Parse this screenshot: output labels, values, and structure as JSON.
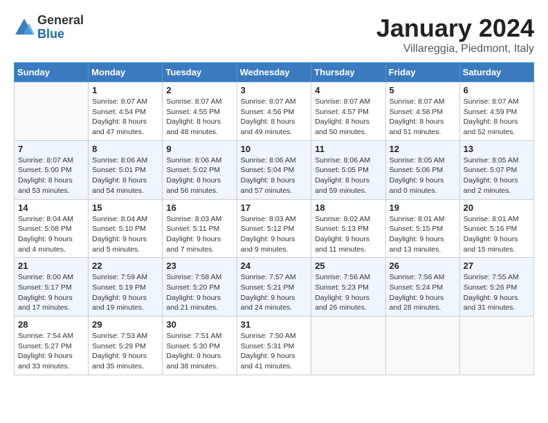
{
  "header": {
    "logo_general": "General",
    "logo_blue": "Blue",
    "title": "January 2024",
    "location": "Villareggia, Piedmont, Italy"
  },
  "weekdays": [
    "Sunday",
    "Monday",
    "Tuesday",
    "Wednesday",
    "Thursday",
    "Friday",
    "Saturday"
  ],
  "days": [
    {
      "day": "",
      "info": ""
    },
    {
      "day": "1",
      "info": "Sunrise: 8:07 AM\nSunset: 4:54 PM\nDaylight: 8 hours\nand 47 minutes."
    },
    {
      "day": "2",
      "info": "Sunrise: 8:07 AM\nSunset: 4:55 PM\nDaylight: 8 hours\nand 48 minutes."
    },
    {
      "day": "3",
      "info": "Sunrise: 8:07 AM\nSunset: 4:56 PM\nDaylight: 8 hours\nand 49 minutes."
    },
    {
      "day": "4",
      "info": "Sunrise: 8:07 AM\nSunset: 4:57 PM\nDaylight: 8 hours\nand 50 minutes."
    },
    {
      "day": "5",
      "info": "Sunrise: 8:07 AM\nSunset: 4:58 PM\nDaylight: 8 hours\nand 51 minutes."
    },
    {
      "day": "6",
      "info": "Sunrise: 8:07 AM\nSunset: 4:59 PM\nDaylight: 8 hours\nand 52 minutes."
    },
    {
      "day": "7",
      "info": "Sunrise: 8:07 AM\nSunset: 5:00 PM\nDaylight: 8 hours\nand 53 minutes."
    },
    {
      "day": "8",
      "info": "Sunrise: 8:06 AM\nSunset: 5:01 PM\nDaylight: 8 hours\nand 54 minutes."
    },
    {
      "day": "9",
      "info": "Sunrise: 8:06 AM\nSunset: 5:02 PM\nDaylight: 8 hours\nand 56 minutes."
    },
    {
      "day": "10",
      "info": "Sunrise: 8:06 AM\nSunset: 5:04 PM\nDaylight: 8 hours\nand 57 minutes."
    },
    {
      "day": "11",
      "info": "Sunrise: 8:06 AM\nSunset: 5:05 PM\nDaylight: 8 hours\nand 59 minutes."
    },
    {
      "day": "12",
      "info": "Sunrise: 8:05 AM\nSunset: 5:06 PM\nDaylight: 9 hours\nand 0 minutes."
    },
    {
      "day": "13",
      "info": "Sunrise: 8:05 AM\nSunset: 5:07 PM\nDaylight: 9 hours\nand 2 minutes."
    },
    {
      "day": "14",
      "info": "Sunrise: 8:04 AM\nSunset: 5:08 PM\nDaylight: 9 hours\nand 4 minutes."
    },
    {
      "day": "15",
      "info": "Sunrise: 8:04 AM\nSunset: 5:10 PM\nDaylight: 9 hours\nand 5 minutes."
    },
    {
      "day": "16",
      "info": "Sunrise: 8:03 AM\nSunset: 5:11 PM\nDaylight: 9 hours\nand 7 minutes."
    },
    {
      "day": "17",
      "info": "Sunrise: 8:03 AM\nSunset: 5:12 PM\nDaylight: 9 hours\nand 9 minutes."
    },
    {
      "day": "18",
      "info": "Sunrise: 8:02 AM\nSunset: 5:13 PM\nDaylight: 9 hours\nand 11 minutes."
    },
    {
      "day": "19",
      "info": "Sunrise: 8:01 AM\nSunset: 5:15 PM\nDaylight: 9 hours\nand 13 minutes."
    },
    {
      "day": "20",
      "info": "Sunrise: 8:01 AM\nSunset: 5:16 PM\nDaylight: 9 hours\nand 15 minutes."
    },
    {
      "day": "21",
      "info": "Sunrise: 8:00 AM\nSunset: 5:17 PM\nDaylight: 9 hours\nand 17 minutes."
    },
    {
      "day": "22",
      "info": "Sunrise: 7:59 AM\nSunset: 5:19 PM\nDaylight: 9 hours\nand 19 minutes."
    },
    {
      "day": "23",
      "info": "Sunrise: 7:58 AM\nSunset: 5:20 PM\nDaylight: 9 hours\nand 21 minutes."
    },
    {
      "day": "24",
      "info": "Sunrise: 7:57 AM\nSunset: 5:21 PM\nDaylight: 9 hours\nand 24 minutes."
    },
    {
      "day": "25",
      "info": "Sunrise: 7:56 AM\nSunset: 5:23 PM\nDaylight: 9 hours\nand 26 minutes."
    },
    {
      "day": "26",
      "info": "Sunrise: 7:56 AM\nSunset: 5:24 PM\nDaylight: 9 hours\nand 28 minutes."
    },
    {
      "day": "27",
      "info": "Sunrise: 7:55 AM\nSunset: 5:26 PM\nDaylight: 9 hours\nand 31 minutes."
    },
    {
      "day": "28",
      "info": "Sunrise: 7:54 AM\nSunset: 5:27 PM\nDaylight: 9 hours\nand 33 minutes."
    },
    {
      "day": "29",
      "info": "Sunrise: 7:53 AM\nSunset: 5:29 PM\nDaylight: 9 hours\nand 35 minutes."
    },
    {
      "day": "30",
      "info": "Sunrise: 7:51 AM\nSunset: 5:30 PM\nDaylight: 9 hours\nand 38 minutes."
    },
    {
      "day": "31",
      "info": "Sunrise: 7:50 AM\nSunset: 5:31 PM\nDaylight: 9 hours\nand 41 minutes."
    },
    {
      "day": "",
      "info": ""
    },
    {
      "day": "",
      "info": ""
    },
    {
      "day": "",
      "info": ""
    }
  ]
}
